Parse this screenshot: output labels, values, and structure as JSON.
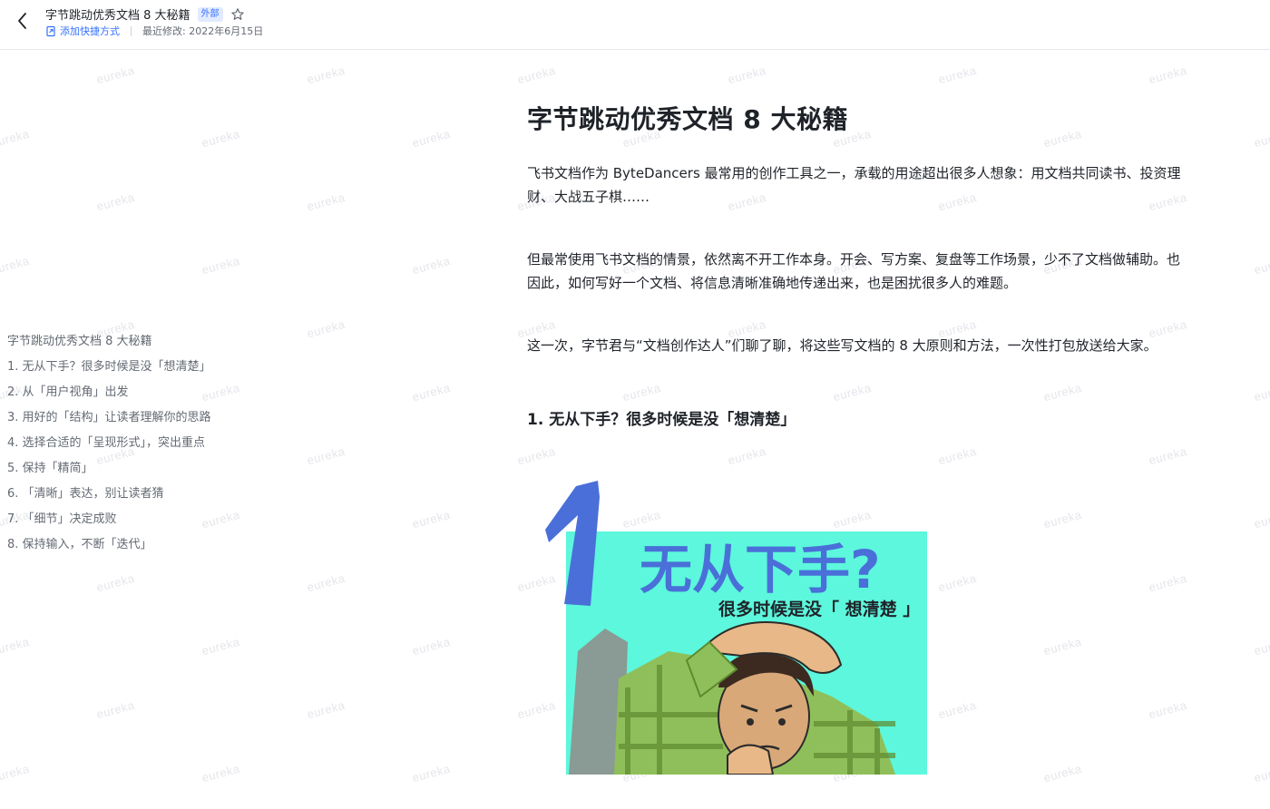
{
  "header": {
    "doc_title": "字节跳动优秀文档 8 大秘籍",
    "badge": "外部",
    "shortcut_label": "添加快捷方式",
    "last_modified": "最近修改: 2022年6月15日"
  },
  "watermark": {
    "text": "eureka"
  },
  "outline": {
    "root": "字节跳动优秀文档 8 大秘籍",
    "items": [
      "1. 无从下手？很多时候是没「想清楚」",
      "2. 从「用户视角」出发",
      "3. 用好的「结构」让读者理解你的思路",
      "4. 选择合适的「呈现形式」，突出重点",
      "5. 保持「精简」",
      "6. 「清晰」表达，别让读者猜",
      "7. 「细节」决定成败",
      "8. 保持输入，不断「迭代」"
    ]
  },
  "doc": {
    "title": "字节跳动优秀文档 8 大秘籍",
    "paragraphs": [
      "飞书文档作为 ByteDancers 最常用的创作工具之一，承载的用途超出很多人想象：用文档共同读书、投资理财、大战五子棋……",
      "但最常使用飞书文档的情景，依然离不开工作本身。开会、写方案、复盘等工作场景，少不了文档做辅助。也因此，如何写好一个文档、将信息清晰准确地传递出来，也是困扰很多人的难题。",
      "这一次，字节君与“文档创作达人”们聊了聊，将这些写文档的 8 大原则和方法，一次性打包放送给大家。"
    ],
    "section1_heading": "1. 无从下手？很多时候是没「想清楚」"
  },
  "illustration": {
    "number": "1",
    "headline": "无从下手?",
    "subline": "很多时候是没「 想清楚 」",
    "colors": {
      "bg": "#5cf7dc",
      "number": "#4a6fd8",
      "headline": "#4a6fd8",
      "plaid": "#8fbf5a"
    }
  }
}
